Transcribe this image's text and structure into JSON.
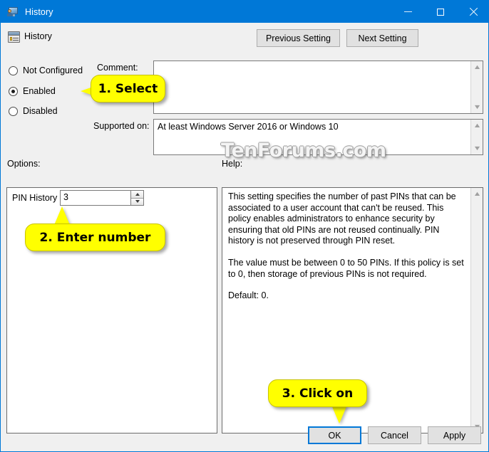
{
  "window": {
    "title": "History",
    "icon": "policy-monitor-icon",
    "accent_color": "#0078d7",
    "chrome_color": "#f0f0f0",
    "controls": {
      "minimize": "–",
      "maximize": "☐",
      "close": "✕"
    }
  },
  "header": {
    "setting_name": "History",
    "icon": "policy-setting-icon",
    "previous_button": "Previous Setting",
    "next_button": "Next Setting"
  },
  "state": {
    "options": [
      {
        "id": "not-configured",
        "label": "Not Configured",
        "selected": false
      },
      {
        "id": "enabled",
        "label": "Enabled",
        "selected": true
      },
      {
        "id": "disabled",
        "label": "Disabled",
        "selected": false
      }
    ]
  },
  "comment": {
    "label": "Comment:",
    "value": "",
    "placeholder": ""
  },
  "supported_on": {
    "label": "Supported on:",
    "value": "At least Windows Server 2016 or Windows 10"
  },
  "options_panel": {
    "label": "Options:",
    "pin_history": {
      "label": "PIN History",
      "value": "3",
      "spinner_up_icon": "triangle-up-icon",
      "spinner_down_icon": "triangle-down-icon"
    }
  },
  "help_panel": {
    "label": "Help:",
    "paragraphs": [
      "This setting specifies the number of past PINs that can be associated to a user account that can't be reused. This policy enables administrators to enhance security by ensuring that old PINs are not reused continually. PIN history is not preserved through PIN reset.",
      "The value must be between 0 to 50 PINs. If this policy is set to 0, then storage of previous PINs is not required.",
      "Default: 0."
    ]
  },
  "footer": {
    "ok": "OK",
    "cancel": "Cancel",
    "apply": "Apply"
  },
  "watermark": {
    "text": "TenForums.com"
  },
  "callouts": [
    {
      "id": "select",
      "text": "1. Select"
    },
    {
      "id": "enter-number",
      "text": "2. Enter number"
    },
    {
      "id": "click-on",
      "text": "3. Click on"
    }
  ]
}
